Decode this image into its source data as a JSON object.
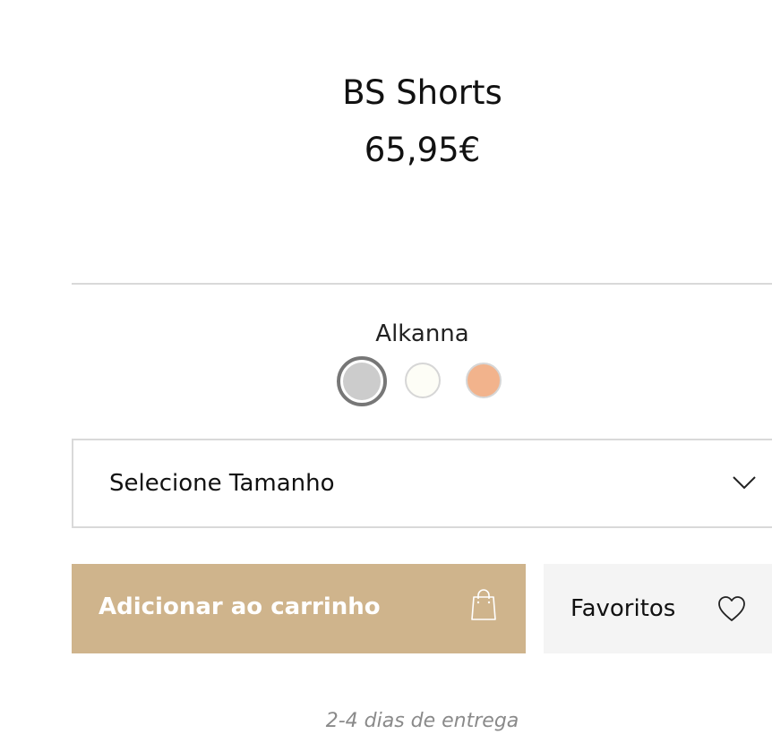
{
  "product": {
    "title": "BS Shorts",
    "price": "65,95€"
  },
  "color": {
    "selected_name": "Alkanna",
    "swatches": [
      {
        "color": "#cccccc",
        "selected": true
      },
      {
        "color": "#fdfdf6",
        "selected": false
      },
      {
        "color": "#f2b38c",
        "selected": false
      }
    ]
  },
  "size_select": {
    "label": "Selecione Tamanho",
    "icon": "chevron-down-icon"
  },
  "actions": {
    "add_to_cart_label": "Adicionar ao carrinho",
    "add_to_cart_icon": "shopping-bag-icon",
    "add_to_cart_color": "#cfb48c",
    "favorites_label": "Favoritos",
    "favorites_icon": "heart-icon"
  },
  "delivery": {
    "text": "2-4 dias de entrega"
  }
}
